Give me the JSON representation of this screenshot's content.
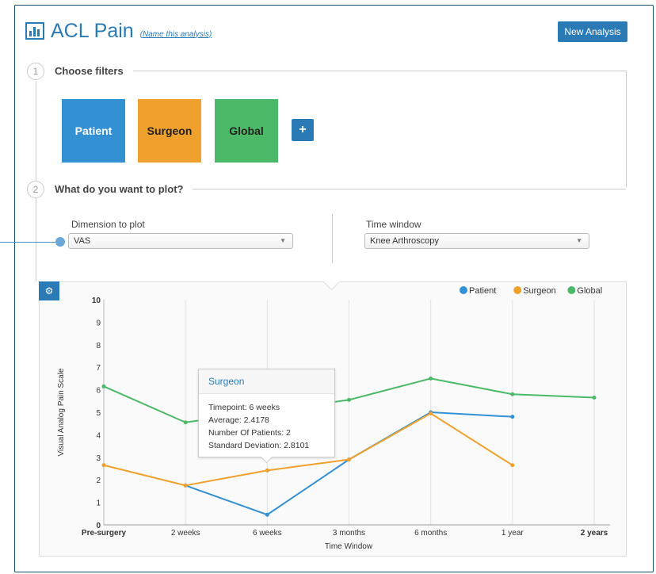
{
  "header": {
    "title": "ACL Pain",
    "name_link": "(Name this analysis)",
    "new_analysis": "New Analysis"
  },
  "steps": [
    {
      "number": "1",
      "label": "Choose filters"
    },
    {
      "number": "2",
      "label": "What do you want to plot?"
    }
  ],
  "filters": [
    {
      "label": "Patient",
      "color": "#3391d3"
    },
    {
      "label": "Surgeon",
      "color": "#f0a02d"
    },
    {
      "label": "Global",
      "color": "#4cb968"
    }
  ],
  "add_filter": "+",
  "dimension": {
    "label": "Dimension to plot",
    "value": "VAS"
  },
  "time_window": {
    "label": "Time window",
    "value": "Knee Arthroscopy"
  },
  "chart_data": {
    "type": "line",
    "categories": [
      "Pre-surgery",
      "2 weeks",
      "6 weeks",
      "3 months",
      "6 months",
      "1 year",
      "2 years"
    ],
    "series": [
      {
        "name": "Patient",
        "color": "#3391d3",
        "values": [
          null,
          1.75,
          0.45,
          2.9,
          5.0,
          4.8,
          null
        ]
      },
      {
        "name": "Surgeon",
        "color": "#f0a02d",
        "values": [
          2.65,
          1.75,
          2.4178,
          2.9,
          4.95,
          2.65,
          null
        ]
      },
      {
        "name": "Global",
        "color": "#4cb968",
        "values": [
          6.15,
          4.55,
          null,
          5.55,
          6.5,
          5.8,
          5.65
        ]
      }
    ],
    "ylim": [
      0,
      10
    ],
    "yticks": [
      "0",
      "1",
      "2",
      "3",
      "4",
      "5",
      "6",
      "7",
      "8",
      "9",
      "10"
    ],
    "xlabel": "Time Window",
    "ylabel": "Visual Analog Pain Scale",
    "legend": "top-right"
  },
  "tooltip": {
    "title": "Surgeon",
    "timepoint": "Timepoint: 6 weeks",
    "average": "Average: 2.4178",
    "patients": "Number Of Patients: 2",
    "stdev": "Standard Deviation: 2.8101"
  }
}
